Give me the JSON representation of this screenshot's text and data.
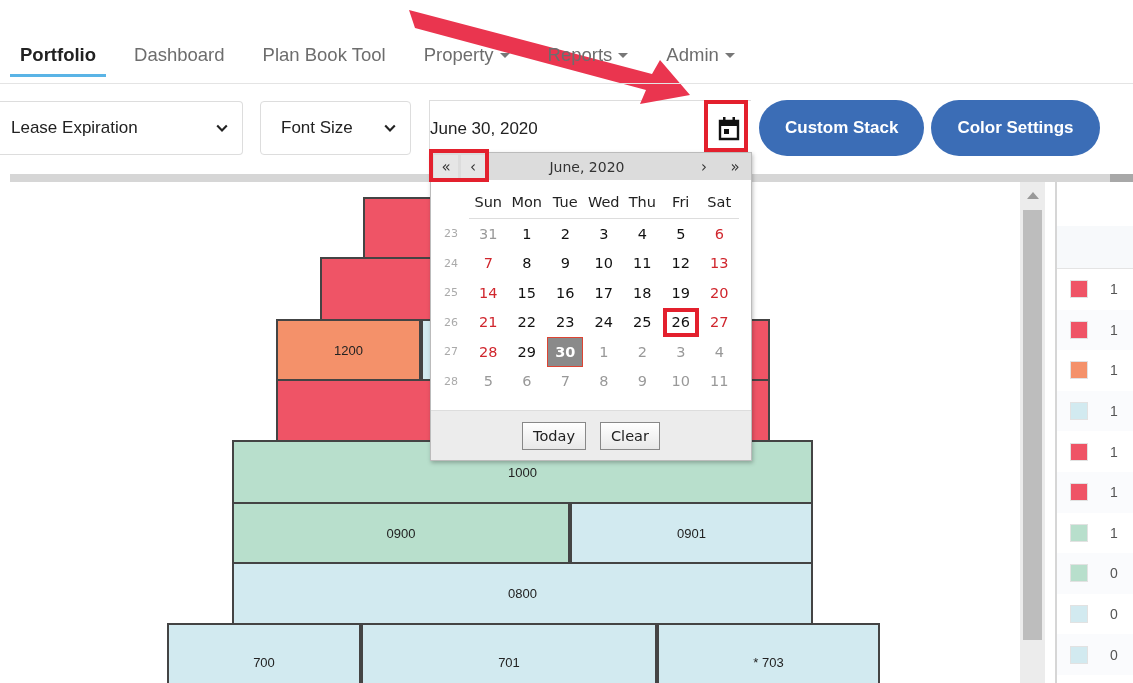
{
  "nav": [
    {
      "label": "Portfolio",
      "selected": true,
      "dropdown": false
    },
    {
      "label": "Dashboard",
      "selected": false,
      "dropdown": false
    },
    {
      "label": "Plan Book Tool",
      "selected": false,
      "dropdown": false
    },
    {
      "label": "Property",
      "selected": false,
      "dropdown": true
    },
    {
      "label": "Reports",
      "selected": false,
      "dropdown": true
    },
    {
      "label": "Admin",
      "selected": false,
      "dropdown": true
    }
  ],
  "toolbar": {
    "selects": [
      {
        "value": "Lease Expiration"
      },
      {
        "value": "Font Size"
      }
    ],
    "date_field": {
      "value": "June 30, 2020"
    },
    "buttons": [
      "Custom Stack",
      "Color Settings"
    ]
  },
  "calendar": {
    "title": "June, 2020",
    "nav_prev": [
      "«",
      "‹"
    ],
    "nav_next": [
      "›",
      "»"
    ],
    "weekdays": [
      "Sun",
      "Mon",
      "Tue",
      "Wed",
      "Thu",
      "Fri",
      "Sat"
    ],
    "weeks": [
      {
        "number": "23",
        "days": [
          {
            "day": "31",
            "kind": "muted",
            "selected": false,
            "marked": false
          },
          {
            "day": "1",
            "kind": "plain",
            "selected": false,
            "marked": false
          },
          {
            "day": "2",
            "kind": "plain",
            "selected": false,
            "marked": false
          },
          {
            "day": "3",
            "kind": "plain",
            "selected": false,
            "marked": false
          },
          {
            "day": "4",
            "kind": "plain",
            "selected": false,
            "marked": false
          },
          {
            "day": "5",
            "kind": "plain",
            "selected": false,
            "marked": false
          },
          {
            "day": "6",
            "kind": "weekend",
            "selected": false,
            "marked": false
          }
        ]
      },
      {
        "number": "24",
        "days": [
          {
            "day": "7",
            "kind": "weekend",
            "selected": false,
            "marked": false
          },
          {
            "day": "8",
            "kind": "plain",
            "selected": false,
            "marked": false
          },
          {
            "day": "9",
            "kind": "plain",
            "selected": false,
            "marked": false
          },
          {
            "day": "10",
            "kind": "plain",
            "selected": false,
            "marked": false
          },
          {
            "day": "11",
            "kind": "plain",
            "selected": false,
            "marked": false
          },
          {
            "day": "12",
            "kind": "plain",
            "selected": false,
            "marked": false
          },
          {
            "day": "13",
            "kind": "weekend",
            "selected": false,
            "marked": false
          }
        ]
      },
      {
        "number": "25",
        "days": [
          {
            "day": "14",
            "kind": "weekend",
            "selected": false,
            "marked": false
          },
          {
            "day": "15",
            "kind": "plain",
            "selected": false,
            "marked": false
          },
          {
            "day": "16",
            "kind": "plain",
            "selected": false,
            "marked": false
          },
          {
            "day": "17",
            "kind": "plain",
            "selected": false,
            "marked": false
          },
          {
            "day": "18",
            "kind": "plain",
            "selected": false,
            "marked": false
          },
          {
            "day": "19",
            "kind": "plain",
            "selected": false,
            "marked": false
          },
          {
            "day": "20",
            "kind": "weekend",
            "selected": false,
            "marked": false
          }
        ]
      },
      {
        "number": "26",
        "days": [
          {
            "day": "21",
            "kind": "weekend",
            "selected": false,
            "marked": false
          },
          {
            "day": "22",
            "kind": "plain",
            "selected": false,
            "marked": false
          },
          {
            "day": "23",
            "kind": "plain",
            "selected": false,
            "marked": false
          },
          {
            "day": "24",
            "kind": "plain",
            "selected": false,
            "marked": false
          },
          {
            "day": "25",
            "kind": "plain",
            "selected": false,
            "marked": false
          },
          {
            "day": "26",
            "kind": "plain",
            "selected": false,
            "marked": true
          },
          {
            "day": "27",
            "kind": "weekend",
            "selected": false,
            "marked": false
          }
        ]
      },
      {
        "number": "27",
        "days": [
          {
            "day": "28",
            "kind": "weekend",
            "selected": false,
            "marked": false
          },
          {
            "day": "29",
            "kind": "plain",
            "selected": false,
            "marked": false
          },
          {
            "day": "30",
            "kind": "plain",
            "selected": true,
            "marked": false
          },
          {
            "day": "1",
            "kind": "muted",
            "selected": false,
            "marked": false
          },
          {
            "day": "2",
            "kind": "muted",
            "selected": false,
            "marked": false
          },
          {
            "day": "3",
            "kind": "muted",
            "selected": false,
            "marked": false
          },
          {
            "day": "4",
            "kind": "muted",
            "selected": false,
            "marked": false
          }
        ]
      },
      {
        "number": "28",
        "days": [
          {
            "day": "5",
            "kind": "muted",
            "selected": false,
            "marked": false
          },
          {
            "day": "6",
            "kind": "muted",
            "selected": false,
            "marked": false
          },
          {
            "day": "7",
            "kind": "muted",
            "selected": false,
            "marked": false
          },
          {
            "day": "8",
            "kind": "muted",
            "selected": false,
            "marked": false
          },
          {
            "day": "9",
            "kind": "muted",
            "selected": false,
            "marked": false
          },
          {
            "day": "10",
            "kind": "muted",
            "selected": false,
            "marked": false
          },
          {
            "day": "11",
            "kind": "muted",
            "selected": false,
            "marked": false
          }
        ]
      }
    ],
    "buttons": [
      "Today",
      "Clear"
    ]
  },
  "stack": {
    "floors": [
      {
        "units": [
          {
            "color": "#ef5466"
          }
        ]
      },
      {
        "units": [
          {
            "color": "#ef5466"
          }
        ]
      },
      {
        "units": [
          {
            "label": "1200",
            "color": "#f4916a"
          },
          {
            "color": "#d2eaf0"
          },
          {
            "color": "#ef5466"
          }
        ]
      },
      {
        "units": [
          {
            "color": "#ef5466"
          }
        ]
      },
      {
        "units": [
          {
            "label": "1000",
            "color": "#b8dfcc"
          }
        ]
      },
      {
        "units": [
          {
            "label": "0900",
            "color": "#b8dfcc"
          },
          {
            "label": "0901",
            "color": "#d2eaf0"
          }
        ]
      },
      {
        "units": [
          {
            "label": "0800",
            "color": "#d2eaf0"
          }
        ]
      },
      {
        "units": [
          {
            "label": "700",
            "color": "#d2eaf0"
          },
          {
            "label": "701",
            "color": "#d2eaf0"
          },
          {
            "label": "* 703",
            "color": "#d2eaf0"
          }
        ]
      }
    ]
  },
  "legend": [
    {
      "color": "#ef5466",
      "text": "1"
    },
    {
      "color": "#ef5466",
      "text": "1"
    },
    {
      "color": "#f4916a",
      "text": "1"
    },
    {
      "color": "#d2eaf0",
      "text": "1"
    },
    {
      "color": "#ef5466",
      "text": "1"
    },
    {
      "color": "#ef5466",
      "text": "1"
    },
    {
      "color": "#b8dfcc",
      "text": "1"
    },
    {
      "color": "#b8dfcc",
      "text": "0"
    },
    {
      "color": "#d2eaf0",
      "text": "0"
    },
    {
      "color": "#d2eaf0",
      "text": "0"
    }
  ]
}
